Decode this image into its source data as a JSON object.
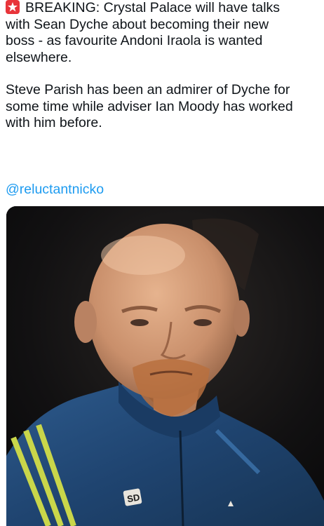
{
  "tweet": {
    "emoji_icon": "red-siren-emoji-icon",
    "lines": [
      "BREAKING: Crystal Palace will have talks",
      "with Sean Dyche about becoming their new",
      "boss - as favourite Andoni Iraola is wanted",
      "elsewhere."
    ],
    "lines2": [
      "Steve Parish has been an admirer of Dyche for",
      "some time while adviser Ian Moody has worked",
      "with him before."
    ],
    "handle": "@reluctantnicko"
  },
  "photo": {
    "jacket_badge": "SD"
  },
  "colors": {
    "link": "#1d9bf0",
    "text": "#0f1419",
    "emoji": "#e8343a"
  }
}
